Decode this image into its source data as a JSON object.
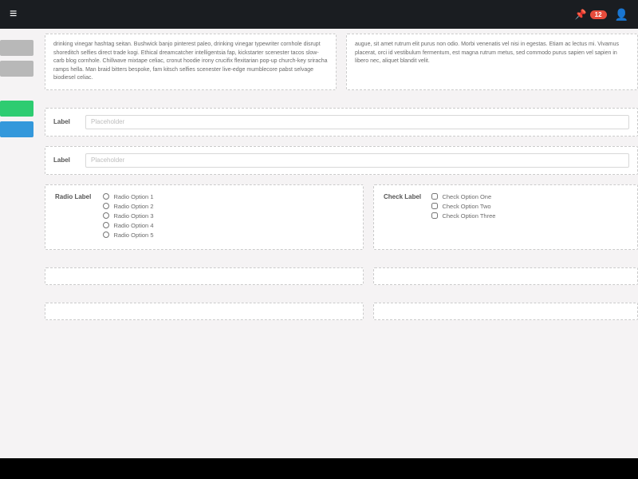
{
  "topbar": {
    "badge_count": "12"
  },
  "text_blocks": {
    "left": "drinking vinegar hashtag seitan. Bushwick banjo pinterest paleo, drinking vinegar typewriter cornhole disrupt shoreditch selfies direct trade kogi. Ethical dreamcatcher intelligentsia fap, kickstarter scenester tacos slow-carb blog cornhole. Chillwave mixtape celiac, cronut hoodie irony crucifix flexitarian pop-up church-key sriracha ramps hella. Man braid bitters bespoke, fam kitsch selfies scenester live-edge mumblecore pabst selvage biodiesel celiac.",
    "right": "augue, sit amet rutrum elit purus non odio. Morbi venenatis vel nisi in egestas. Etiam ac lectus mi. Vivamus placerat, orci id vestibulum fermentum, est magna rutrum metus, sed commodo purus sapien vel sapien in libero nec, aliquet blandit velit."
  },
  "form": {
    "field1": {
      "label": "Label",
      "placeholder": "Placeholder"
    },
    "field2": {
      "label": "Label",
      "placeholder": "Placeholder"
    }
  },
  "radio_group": {
    "label": "Radio Label",
    "options": [
      "Radio Option 1",
      "Radio Option 2",
      "Radio Option 3",
      "Radio Option 4",
      "Radio Option 5"
    ]
  },
  "check_group": {
    "label": "Check Label",
    "options": [
      "Check Option One",
      "Check Option Two",
      "Check Option Three"
    ]
  }
}
